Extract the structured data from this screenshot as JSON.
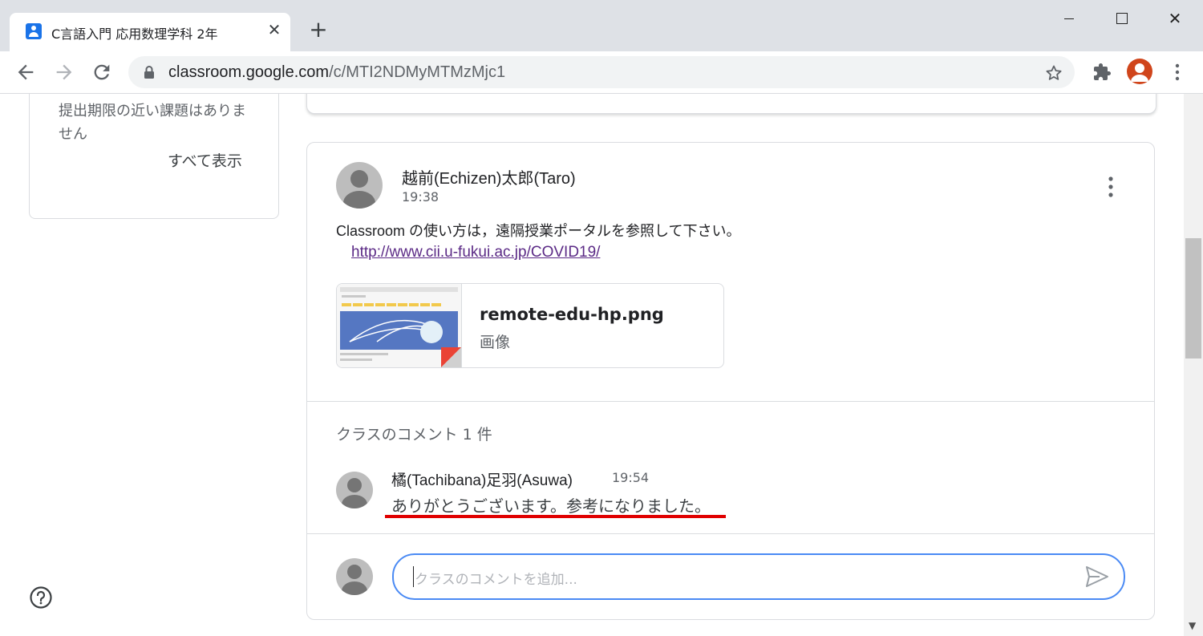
{
  "browser": {
    "tab_title": "C言語入門 応用数理学科 2年",
    "tab_close": "✕",
    "new_tab": "+",
    "window_close": "✕",
    "url_host": "classroom.google.com",
    "url_path": "/c/MTI2NDMyMTMzMjc1"
  },
  "sidebar": {
    "upcoming_text": "提出期限の近い課題はありません",
    "view_all": "すべて表示"
  },
  "post": {
    "author": "越前(Echizen)太郎(Taro)",
    "time": "19:38",
    "body": "Classroom の使い方は，遠隔授業ポータルを参照して下さい。",
    "link": "http://www.cii.u-fukui.ac.jp/COVID19/",
    "attachment": {
      "name": "remote-edu-hp.png",
      "type": "画像"
    }
  },
  "comments": {
    "header": "クラスのコメント 1 件",
    "items": [
      {
        "author": "橘(Tachibana)足羽(Asuwa)",
        "time": "19:54",
        "text": "ありがとうございます。参考になりました。"
      }
    ],
    "input_placeholder": "クラスのコメントを追加..."
  },
  "colors": {
    "accent": "#1a73e8",
    "input_border": "#4a8af4",
    "highlight_underline": "#e00000",
    "link": "#5b2a86"
  }
}
